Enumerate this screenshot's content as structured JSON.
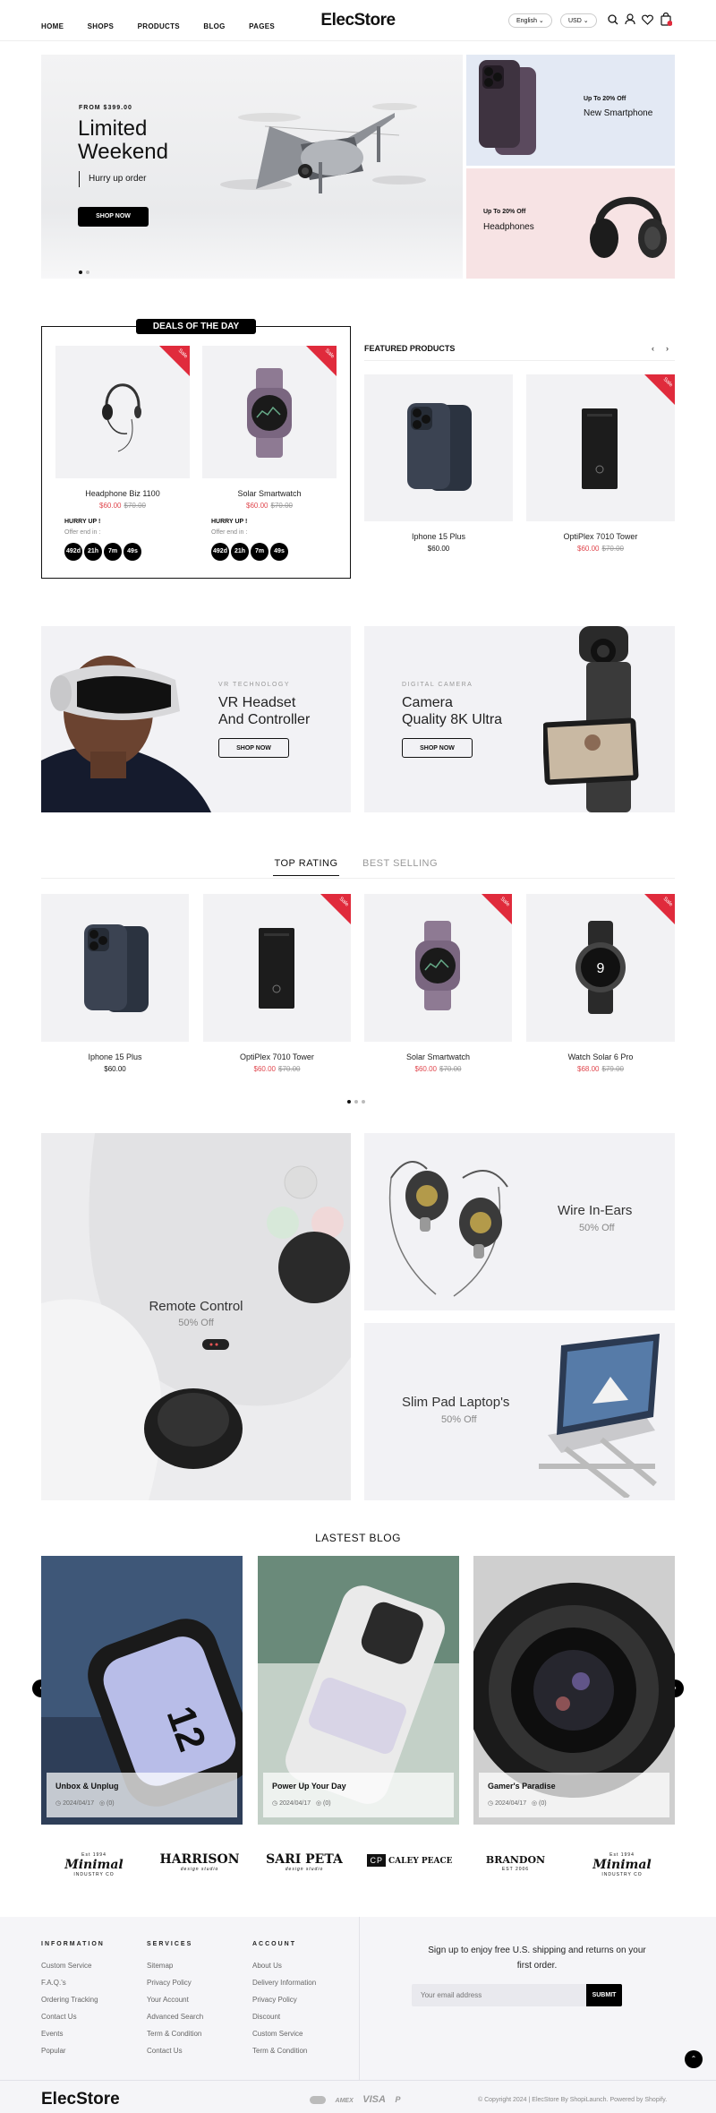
{
  "header": {
    "nav": [
      "HOME",
      "SHOPS",
      "PRODUCTS",
      "BLOG",
      "PAGES"
    ],
    "logo": "ElecStore",
    "language": "English",
    "currency": "USD"
  },
  "hero": {
    "kicker": "FROM $399.00",
    "title_line1": "Limited",
    "title_line2": "Weekend",
    "subtitle": "Hurry up order",
    "button": "SHOP NOW",
    "side1": {
      "tag": "Up To 20% Off",
      "title": "New Smartphone"
    },
    "side2": {
      "tag": "Up To 20% Off",
      "title": "Headphones"
    }
  },
  "deals": {
    "title": "DEALS OF THE DAY",
    "items": [
      {
        "name": "Headphone Biz 1100",
        "price": "$60.00",
        "old": "$70.00",
        "badge": "Sale",
        "hurry": "HURRY UP !",
        "offer": "Offer end in :",
        "timer": [
          "492d",
          "21h",
          "7m",
          "49s"
        ]
      },
      {
        "name": "Solar Smartwatch",
        "price": "$60.00",
        "old": "$70.00",
        "badge": "Sale",
        "hurry": "HURRY UP !",
        "offer": "Offer end in :",
        "timer": [
          "492d",
          "21h",
          "7m",
          "49s"
        ]
      }
    ]
  },
  "featured": {
    "title": "FEATURED PRODUCTS",
    "items": [
      {
        "name": "Iphone 15 Plus",
        "price": "$60.00"
      },
      {
        "name": "OptiPlex 7010 Tower",
        "price": "$60.00",
        "old": "$70.00",
        "badge": "Sale"
      }
    ]
  },
  "promos": [
    {
      "kicker": "VR TECHNOLOGY",
      "line1": "VR Headset",
      "line2": "And Controller",
      "button": "SHOP NOW"
    },
    {
      "kicker": "DIGITAL CAMERA",
      "line1": "Camera",
      "line2": "Quality 8K Ultra",
      "button": "SHOP NOW"
    }
  ],
  "tabs": {
    "active": "TOP RATING",
    "inactive": "BEST SELLING"
  },
  "products": [
    {
      "name": "Iphone 15 Plus",
      "price": "$60.00"
    },
    {
      "name": "OptiPlex 7010 Tower",
      "price": "$60.00",
      "old": "$70.00",
      "badge": "Sale"
    },
    {
      "name": "Solar Smartwatch",
      "price": "$60.00",
      "old": "$70.00",
      "badge": "Sale"
    },
    {
      "name": "Watch Solar 6 Pro",
      "price": "$68.00",
      "old": "$79.00",
      "badge": "Sale"
    }
  ],
  "banners": {
    "remote": {
      "title": "Remote Control",
      "sub": "50% Off"
    },
    "ears": {
      "title": "Wire In-Ears",
      "sub": "50% Off"
    },
    "laptop": {
      "title": "Slim Pad Laptop's",
      "sub": "50% Off"
    }
  },
  "blog": {
    "title": "LASTEST BLOG",
    "posts": [
      {
        "title": "Unbox & Unplug",
        "date": "2024/04/17",
        "comments": "(0)"
      },
      {
        "title": "Power Up Your Day",
        "date": "2024/04/17",
        "comments": "(0)"
      },
      {
        "title": "Gamer's Paradise",
        "date": "2024/04/17",
        "comments": "(0)"
      }
    ]
  },
  "brands": [
    {
      "name": "Minimal",
      "top": "Est 1994",
      "bottom": "INDUSTRY CO"
    },
    {
      "name": "HARRISON",
      "top": "",
      "bottom": "design studio"
    },
    {
      "name": "SARI PETA",
      "top": "",
      "bottom": "design studio"
    },
    {
      "name": "CALEY PEACE",
      "top": "CP",
      "bottom": ""
    },
    {
      "name": "BRANDON",
      "top": "",
      "bottom": "EST 2006"
    },
    {
      "name": "Minimal",
      "top": "Est 1994",
      "bottom": "INDUSTRY CO"
    }
  ],
  "footer": {
    "col1": {
      "title": "INFORMATION",
      "links": [
        "Custom Service",
        "F.A.Q.'s",
        "Ordering Tracking",
        "Contact Us",
        "Events",
        "Popular"
      ]
    },
    "col2": {
      "title": "SERVICES",
      "links": [
        "Sitemap",
        "Privacy Policy",
        "Your Account",
        "Advanced Search",
        "Term & Condition",
        "Contact Us"
      ]
    },
    "col3": {
      "title": "ACCOUNT",
      "links": [
        "About Us",
        "Delivery Information",
        "Privacy Policy",
        "Discount",
        "Custom Service",
        "Term & Condition"
      ]
    },
    "newsletter_line1": "Sign up to enjoy free U.S. shipping and returns on your",
    "newsletter_line2": "first order.",
    "email_placeholder": "Your email address",
    "submit": "SUBMIT",
    "logo": "ElecStore",
    "payments": [
      "AMEX",
      "VISA",
      "P"
    ],
    "copyright": "© Copyright 2024 | ElecStore By ShopiLaunch. Powered by Shopify."
  },
  "colors": {
    "sale": "#e02b3c",
    "price_red": "#e0484f",
    "card_bg": "#f2f2f4",
    "hero_blue": "#e3e9f4",
    "hero_pink": "#f7e3e4",
    "footer_bg": "#f5f5f8"
  }
}
